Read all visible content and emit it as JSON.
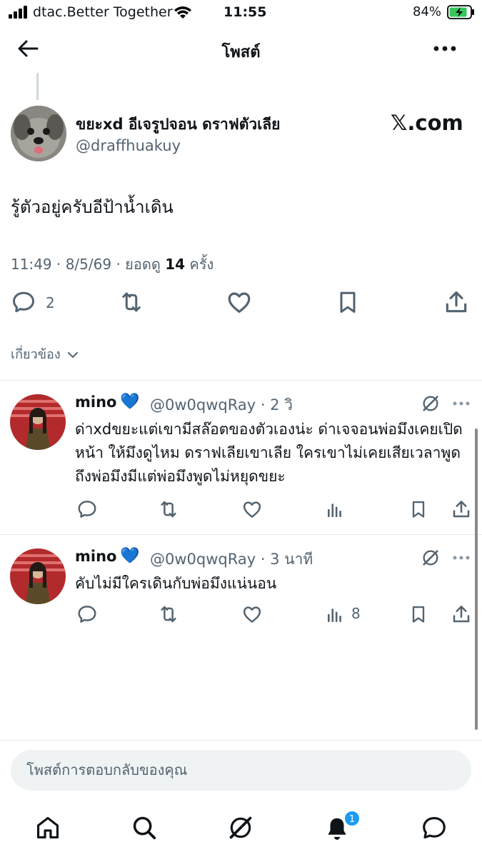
{
  "status_bar": {
    "carrier": "dtac.Better Together",
    "time": "11:55",
    "battery_percent": "84%"
  },
  "header": {
    "title": "โพสต์"
  },
  "post": {
    "author_name": "ขยะxd อีเจรูปจอน ดราฟตัวเลีย",
    "author_handle": "@draffhuakuy",
    "source_label": "𝕏.com",
    "text": "รู้ตัวอยู่ครับอีป้าน้ำเดิน",
    "meta_prefix": "11:49 · 8/5/69 · ยอดดู ",
    "views": "14",
    "meta_suffix": " ครั้ง",
    "reply_count": "2"
  },
  "related": {
    "label": "เกี่ยวข้อง"
  },
  "replies": [
    {
      "name": "mino",
      "heart": "💙",
      "handle_time": "@0w0qwqRay · 2 วิ",
      "text": "ด่าxdขยะแต่เขามีสล๊อตของตัวเองน่ะ ด่าเจจอนพ่อมึงเคยเปิดหน้า ให้มึงดูไหม ดราฟเลียเขาเลีย ใครเขาไม่เคยเสียเวลาพูดถึงพ่อมึงมีแต่พ่อมึงพูดไม่หยุดขยะ",
      "views": ""
    },
    {
      "name": "mino",
      "heart": "💙",
      "handle_time": "@0w0qwqRay · 3 นาที",
      "text": "คับไม่มีใครเดินกับพ่อมึงแน่นอน",
      "views": "8"
    }
  ],
  "composer": {
    "placeholder": "โพสต์การตอบกลับของคุณ"
  },
  "tab_bar": {
    "notification_count": "1"
  },
  "colors": {
    "accent": "#1d9bf0",
    "text": "#0f1419",
    "muted": "#536471",
    "battery": "#34c759"
  },
  "icons": [
    "back-arrow-icon",
    "more-icon",
    "reply-icon",
    "retweet-icon",
    "like-icon",
    "bookmark-icon",
    "share-icon",
    "views-icon",
    "grok-icon",
    "home-icon",
    "search-icon",
    "bell-icon",
    "messages-icon"
  ]
}
